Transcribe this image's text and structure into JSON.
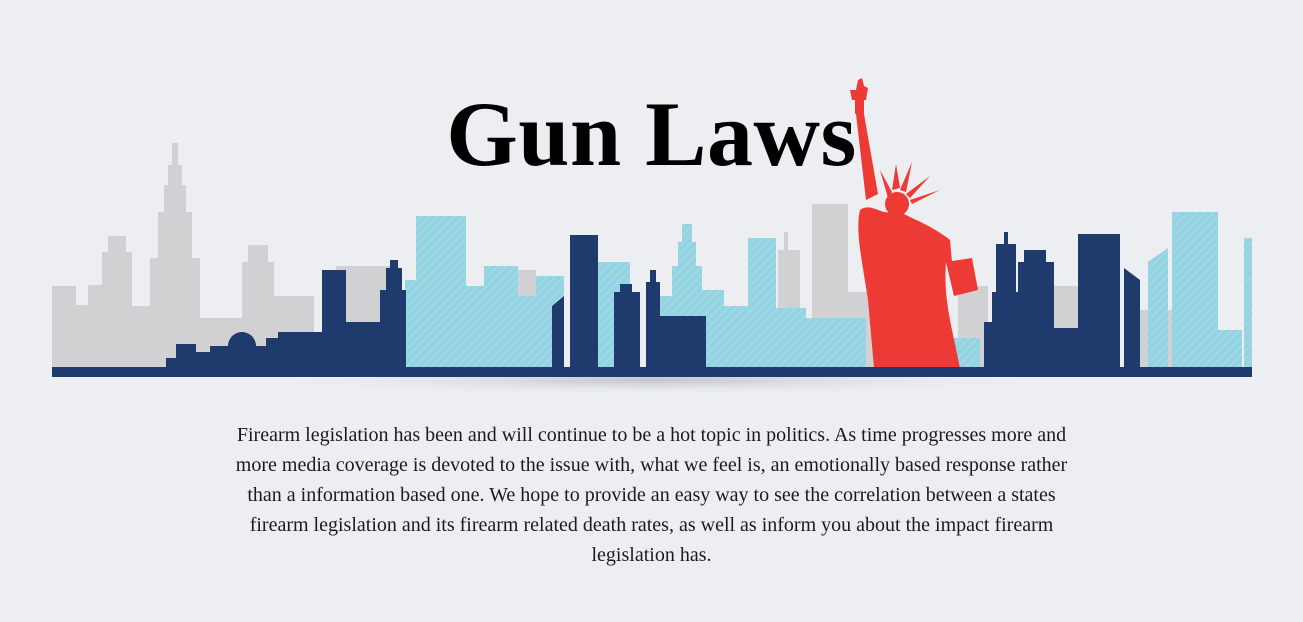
{
  "header": {
    "title": "Gun Laws"
  },
  "banner": {
    "image": "city-skyline-with-statue-of-liberty",
    "colors": {
      "background_buildings": "#d1d1d3",
      "middle_buildings": "#93d3e2",
      "front_buildings": "#1f3b6e",
      "statue": "#ee3a35",
      "ground": "#1f3b6e"
    }
  },
  "intro": {
    "text": "Firearm legislation has been and will continue to be a hot topic in politics. As time progresses more and more media coverage is devoted to the issue with, what we feel is, an emotionally based response rather than a information based one. We hope to provide an easy way to see the correlation between a states firearm legislation and its firearm related death rates, as well as inform you about the impact firearm legislation has."
  }
}
